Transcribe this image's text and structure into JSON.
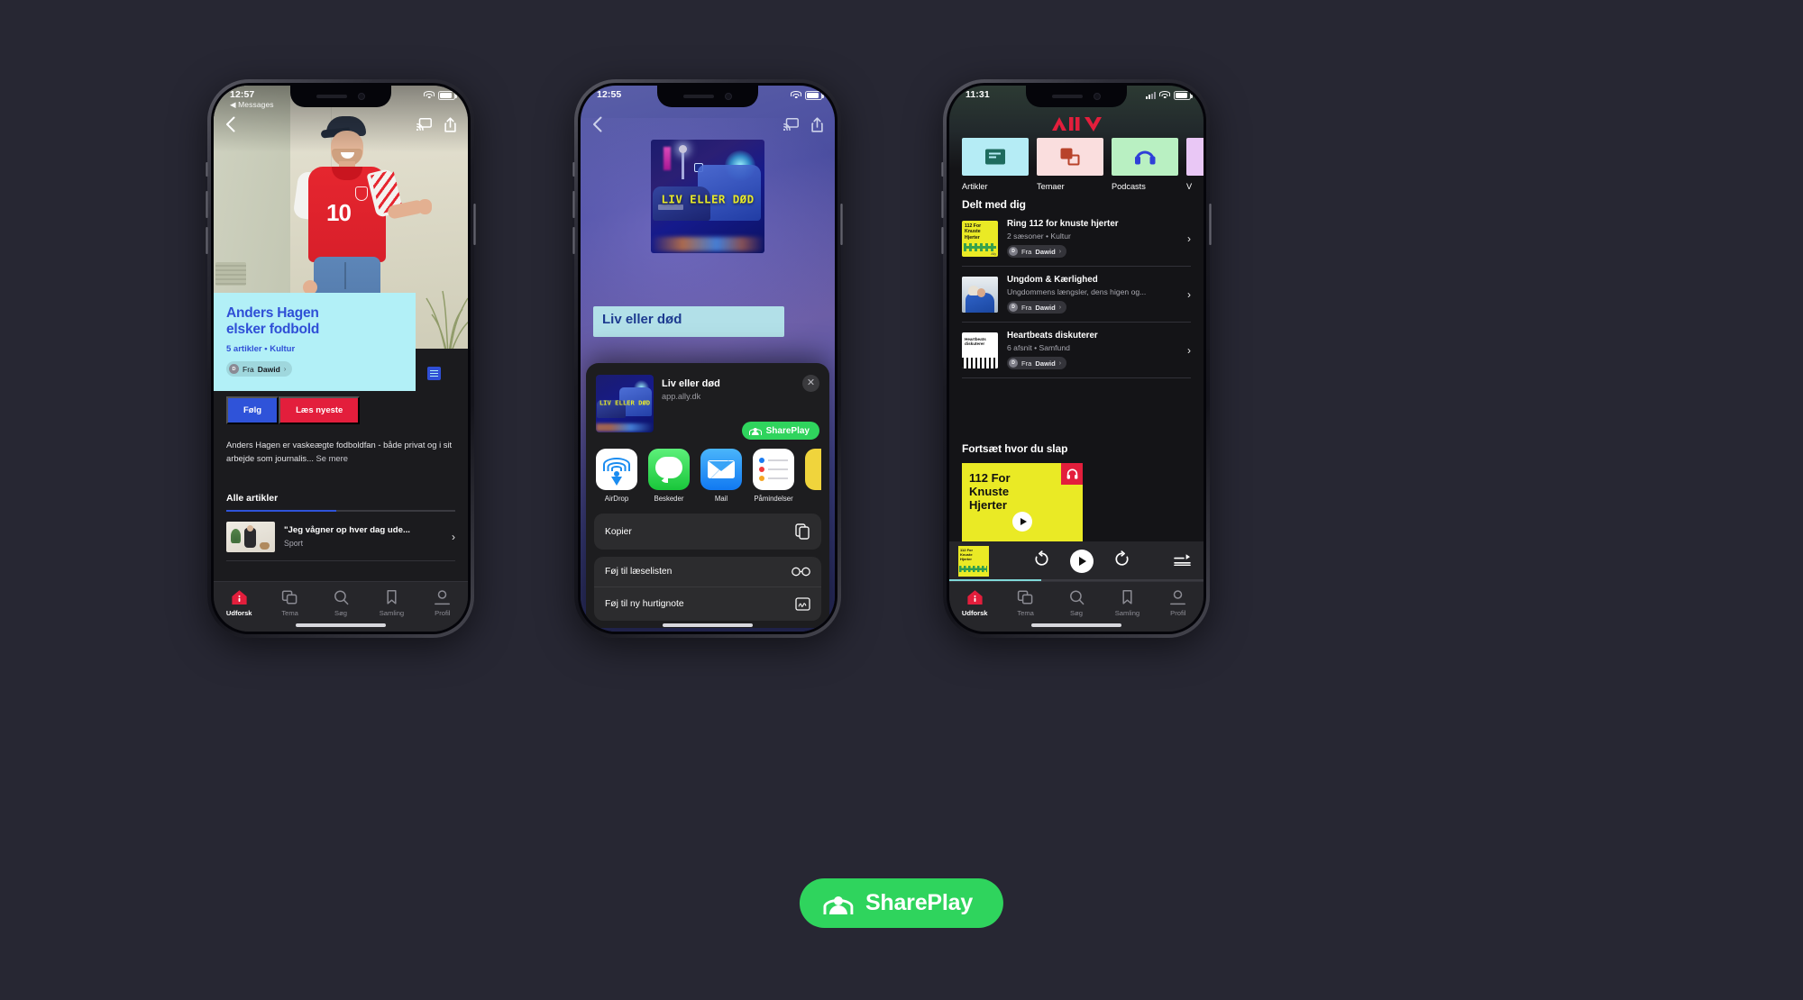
{
  "background_color": "#272733",
  "phone1": {
    "status": {
      "time": "12:57",
      "back_app": "Messages",
      "wifi": "wifi-icon",
      "battery": "battery-icon"
    },
    "topnav": {
      "back": "chevron-left-icon",
      "cast": "airplay-icon",
      "share": "share-icon"
    },
    "hero": {
      "alt": "Man in red Denmark football jersey number 10"
    },
    "card": {
      "title_line1": "Anders Hagen",
      "title_line2": "elsker fodbold",
      "meta": "5 artikler • Kultur",
      "chip_avatar": "D",
      "chip_prefix": "Fra",
      "chip_name": "Dawid",
      "chip_chevron": "›",
      "accent_bg": "#b2f0f7",
      "accent_text": "#2f4fd6"
    },
    "buttons": {
      "follow": "Følg",
      "follow_color": "#2f53d9",
      "read": "Læs nyeste",
      "read_color": "#e31e3c"
    },
    "blurb": "Anders Hagen er vaskeægte fodboldfan - både privat og i sit arbejde som journalis...",
    "blurb_more": " Se mere",
    "section": {
      "title": "Alle artikler"
    },
    "article": {
      "title": "\"Jeg vågner op hver dag ude...",
      "category": "Sport",
      "chevron": "›"
    },
    "tabs": [
      {
        "label": "Udforsk",
        "icon": "home-icon",
        "active": true
      },
      {
        "label": "Tema",
        "icon": "layers-icon",
        "active": false
      },
      {
        "label": "Søg",
        "icon": "search-icon",
        "active": false
      },
      {
        "label": "Samling",
        "icon": "bookmark-icon",
        "active": false
      },
      {
        "label": "Profil",
        "icon": "person-icon",
        "active": false
      }
    ]
  },
  "phone2": {
    "status": {
      "time": "12:55",
      "wifi": "wifi-icon",
      "battery": "battery-icon"
    },
    "topnav": {
      "back": "chevron-left-icon",
      "cast": "airplay-icon",
      "share": "share-icon"
    },
    "cover": {
      "text": "LIV ELLER DØD"
    },
    "page_title": "Liv eller død",
    "sheet": {
      "title": "Liv eller død",
      "url": "app.ally.dk",
      "close": "close-icon",
      "shareplay_label": "SharePlay",
      "shareplay_color": "#2fd45d",
      "apps": [
        {
          "name": "AirDrop",
          "icon": "airdrop-icon"
        },
        {
          "name": "Beskeder",
          "icon": "messages-icon"
        },
        {
          "name": "Mail",
          "icon": "mail-icon"
        },
        {
          "name": "Påmindelser",
          "icon": "reminders-icon"
        }
      ],
      "actions_group1": [
        {
          "label": "Kopier",
          "icon": "copy-icon"
        }
      ],
      "actions_group2": [
        {
          "label": "Føj til læselisten",
          "icon": "glasses-icon"
        },
        {
          "label": "Føj til ny hurtignote",
          "icon": "quicknote-icon"
        }
      ]
    }
  },
  "phone3": {
    "status": {
      "time": "11:31",
      "cellular": "cellular-icon",
      "wifi": "wifi-icon",
      "battery": "battery-icon"
    },
    "logo": "Ally",
    "logo_color": "#e31e3c",
    "categories": [
      {
        "label": "Artikler",
        "icon": "article-icon"
      },
      {
        "label": "Temaer",
        "icon": "theme-icon"
      },
      {
        "label": "Podcasts",
        "icon": "headphones-icon"
      },
      {
        "label": "V",
        "icon": "video-icon"
      }
    ],
    "shared_section": {
      "title": "Delt med dig"
    },
    "shared_items": [
      {
        "title": "Ring 112 for knuste hjerter",
        "subtitle": "2 sæsoner • Kultur",
        "chip_avatar": "D",
        "chip_prefix": "Fra",
        "chip_name": "Dawid",
        "chip_chevron": "›",
        "chevron": "›",
        "thumb": "112-for-knuste-hjerter-cover"
      },
      {
        "title": "Ungdom & Kærlighed",
        "subtitle": "Ungdommens længsler, dens higen og...",
        "chip_avatar": "D",
        "chip_prefix": "Fra",
        "chip_name": "Dawid",
        "chip_chevron": "›",
        "chevron": "›",
        "thumb": "ungdom-kaerlighed-cover"
      },
      {
        "title": "Heartbeats diskuterer",
        "subtitle": "6 afsnit • Samfund",
        "chip_avatar": "D",
        "chip_prefix": "Fra",
        "chip_name": "Dawid",
        "chip_chevron": "›",
        "chevron": "›",
        "thumb": "heartbeats-cover"
      }
    ],
    "continue_section": {
      "title": "Fortsæt hvor du slap"
    },
    "continue_card": {
      "title_line1": "112 For",
      "title_line2": "Knuste",
      "title_line3": "Hjerter",
      "badge_icon": "headphones-icon",
      "badge_color": "#e31e3c",
      "play_icon": "play-icon",
      "bg_color": "#eaea25"
    },
    "miniplayer": {
      "artwork_line1": "112 For",
      "artwork_line2": "Knuste",
      "artwork_line3": "Hjerter",
      "rewind": "rewind-15-icon",
      "play": "play-icon",
      "forward": "forward-15-icon",
      "queue": "queue-icon",
      "progress_percent": 36
    },
    "tabs": [
      {
        "label": "Udforsk",
        "icon": "home-icon",
        "active": true
      },
      {
        "label": "Tema",
        "icon": "layers-icon",
        "active": false
      },
      {
        "label": "Søg",
        "icon": "search-icon",
        "active": false
      },
      {
        "label": "Samling",
        "icon": "bookmark-icon",
        "active": false
      },
      {
        "label": "Profil",
        "icon": "person-icon",
        "active": false
      }
    ]
  },
  "footer": {
    "shareplay_label": "SharePlay",
    "shareplay_color": "#2fd45d",
    "icon": "shareplay-icon"
  }
}
